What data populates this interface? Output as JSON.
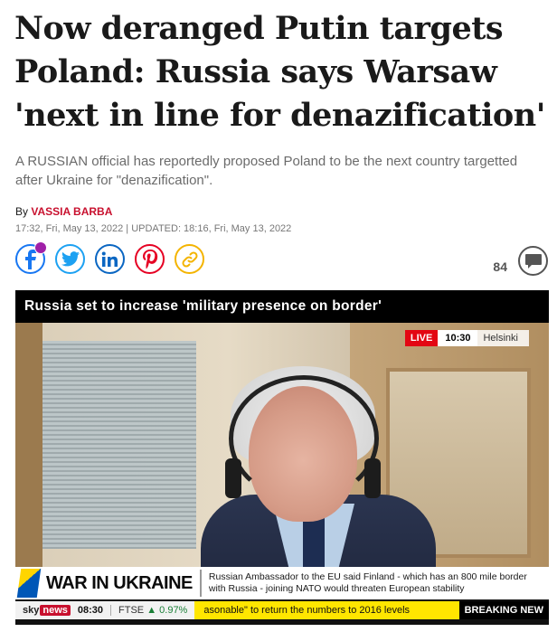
{
  "article": {
    "headline": "Now deranged Putin targets Poland: Russia says Warsaw 'next in line for denazification'",
    "standfirst": "A RUSSIAN official has reportedly proposed Poland to be the next country targetted after Ukraine for \"denazification\".",
    "byline_prefix": "By",
    "author": "VASSIA BARBA",
    "dateline": "17:32, Fri, May 13, 2022 | UPDATED: 18:16, Fri, May 13, 2022"
  },
  "share": {
    "buttons": [
      {
        "name": "facebook",
        "icon": "facebook-icon",
        "glyph": "f"
      },
      {
        "name": "twitter",
        "icon": "twitter-icon",
        "glyph": "t"
      },
      {
        "name": "linkedin",
        "icon": "linkedin-icon",
        "glyph": "in"
      },
      {
        "name": "pinterest",
        "icon": "pinterest-icon",
        "glyph": "P"
      },
      {
        "name": "copy-link",
        "icon": "link-icon",
        "glyph": "🔗"
      }
    ],
    "comment_count": "84"
  },
  "video": {
    "title": "Russia set to increase 'military presence on border'",
    "live_label": "LIVE",
    "time": "10:30",
    "location": "Helsinki",
    "lower_third_title": "WAR IN UKRAINE",
    "caption": "Russian Ambassador to the EU said Finland - which has an 800 mile border with Russia - joining NATO would threaten European stability",
    "ticker": {
      "brand_sky": "sky",
      "brand_news": "news",
      "clock": "08:30",
      "index_name": "FTSE",
      "index_change": "▲ 0.97%",
      "scroll_text": "asonable\" to return the numbers to 2016 levels",
      "breaking_label": "BREAKING NEW"
    }
  },
  "colors": {
    "author": "#c8102e",
    "facebook": "#1877f2",
    "twitter": "#1da1f2",
    "linkedin": "#0a66c2",
    "pinterest": "#e60023",
    "link": "#f4b400",
    "live": "#e30613",
    "ticker_highlight": "#ffe600"
  }
}
